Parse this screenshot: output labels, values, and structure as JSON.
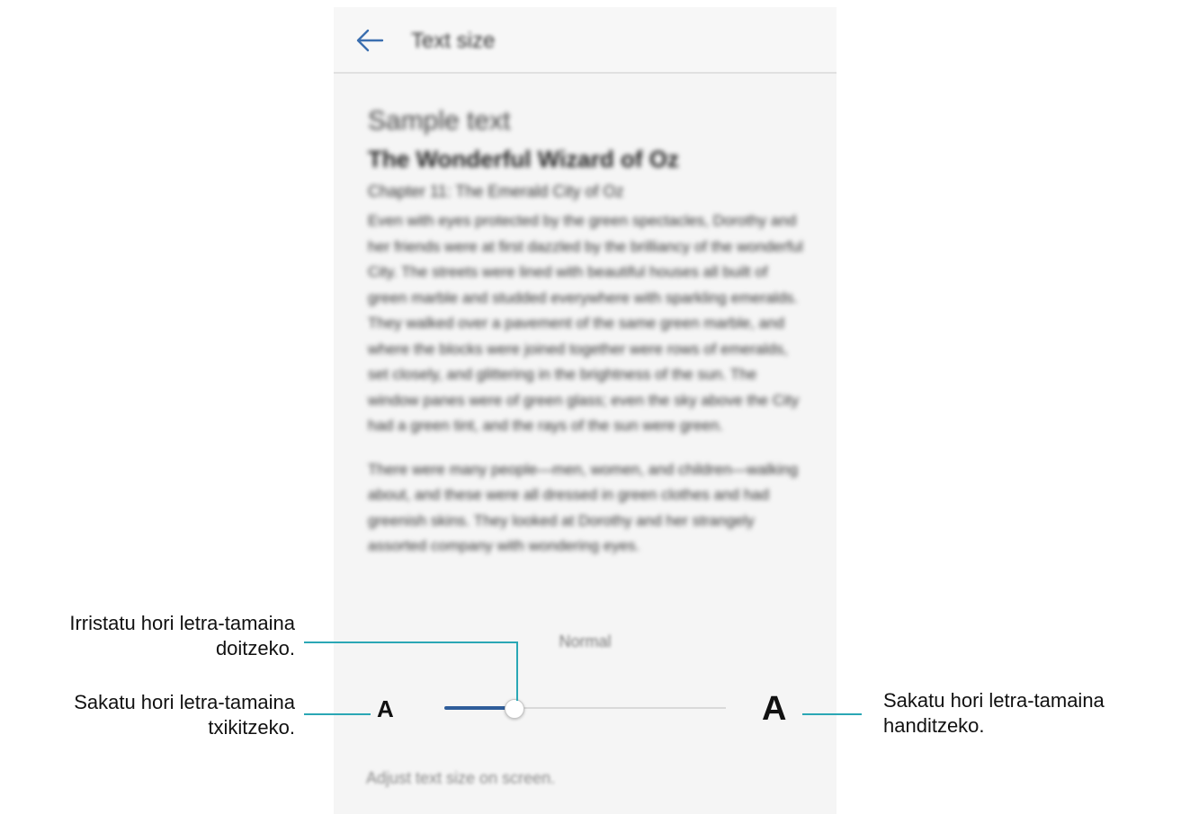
{
  "screen": {
    "title": "Text size",
    "back_icon": "arrow-left-icon",
    "sample": {
      "heading": "Sample text",
      "book_title": "The Wonderful Wizard of Oz",
      "chapter": "Chapter 11: The Emerald City of Oz",
      "paragraph_1": "Even with eyes protected by the green spectacles, Dorothy and her friends were at first dazzled by the brilliancy of the wonderful City. The streets were lined with beautiful houses all built of green marble and studded everywhere with sparkling emeralds. They walked over a pavement of the same green marble, and where the blocks were joined together were rows of emeralds, set closely, and glittering in the brightness of the sun. The window panes were of green glass; even the sky above the City had a green tint, and the rays of the sun were green.",
      "paragraph_2": "There were many people—men, women, and children—walking about, and these were all dressed in green clothes and had greenish skins. They looked at Dorothy and her strangely assorted company with wondering eyes."
    },
    "size_value": "Normal",
    "slider": {
      "value_fraction": 0.25,
      "accent_color": "#2f5d9a"
    },
    "decrease_label": "A",
    "increase_label": "A",
    "hint": "Adjust text size on screen."
  },
  "callouts": {
    "slider_line1": "Irristatu hori letra-tamaina",
    "slider_line2": "doitzeko.",
    "decrease_line1": "Sakatu hori letra-tamaina",
    "decrease_line2": "txikitzeko.",
    "increase_line1": "Sakatu hori letra-tamaina",
    "increase_line2": "handitzeko.",
    "line_color": "#2aa7b5"
  }
}
